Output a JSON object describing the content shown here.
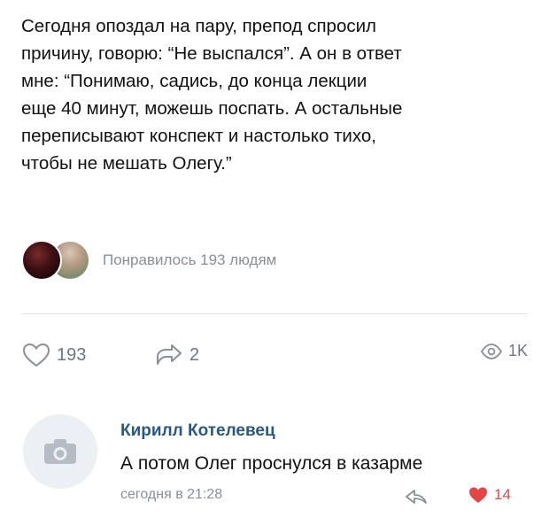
{
  "post": {
    "lines": [
      "Сегодня опоздал на пару, препод спросил",
      "причину, говорю: “Не выспался”. А он в ответ",
      "мне: “Понимаю, садись, до конца лекции",
      "еще 40 минут, можешь поспать. А остальные",
      "переписывают конспект и настолько тихо,",
      "чтобы не мешать Олегу.”"
    ],
    "liked_by_text": "Понравилось 193 людям"
  },
  "actions": {
    "likes": "193",
    "shares": "2",
    "views": "1K"
  },
  "comment": {
    "author": "Кирилл Котелевец",
    "text": "А потом Олег проснулся в казарме",
    "time": "сегодня в 21:28",
    "likes": "14"
  },
  "colors": {
    "link": "#2a5885",
    "muted": "#8a8f96",
    "like_red": "#e64646",
    "divider": "#e1e3e6"
  },
  "icons": [
    "heart-outline-icon",
    "share-icon",
    "eye-icon",
    "camera-icon",
    "reply-icon",
    "heart-filled-icon"
  ]
}
